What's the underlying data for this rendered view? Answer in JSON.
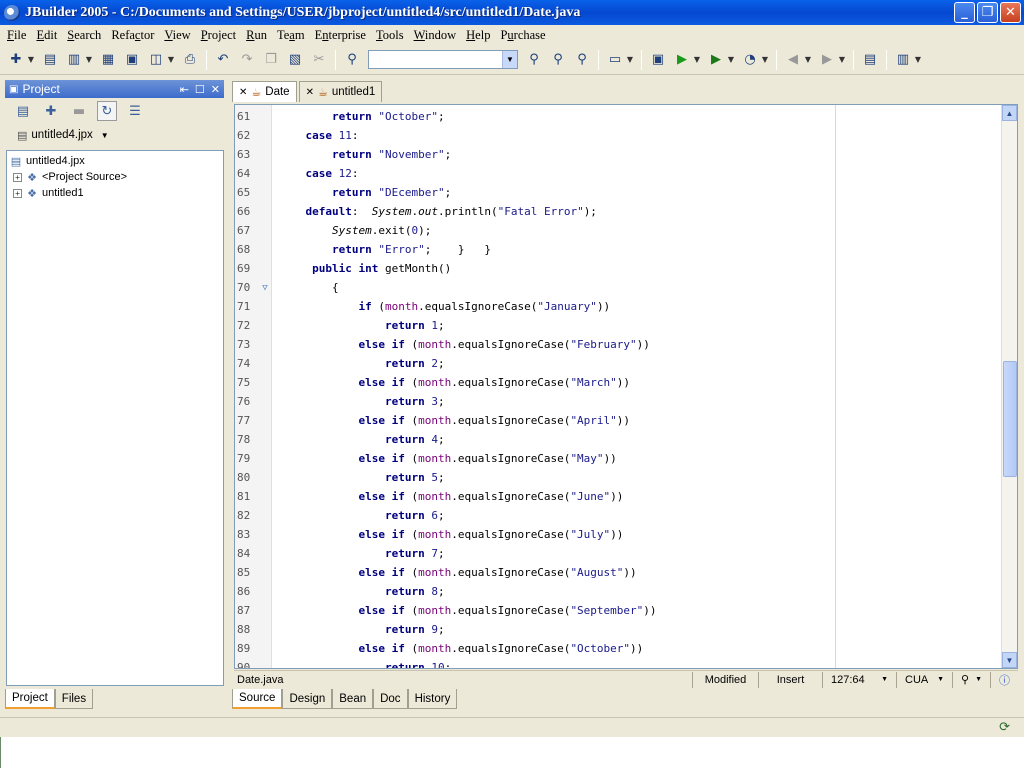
{
  "window": {
    "title": "JBuilder 2005 - C:/Documents and Settings/USER/jbproject/untitled4/src/untitled1/Date.java",
    "buttons": {
      "minimize": "_",
      "maximize": "❐",
      "close": "✕"
    }
  },
  "menu": [
    {
      "u": "F",
      "rest": "ile"
    },
    {
      "u": "E",
      "rest": "dit"
    },
    {
      "u": "S",
      "rest": "earch"
    },
    {
      "pre": "Refa",
      "u": "c",
      "rest": "tor"
    },
    {
      "u": "V",
      "rest": "iew"
    },
    {
      "u": "P",
      "rest": "roject"
    },
    {
      "u": "R",
      "rest": "un"
    },
    {
      "pre": "Te",
      "u": "a",
      "rest": "m"
    },
    {
      "pre": "E",
      "u": "n",
      "rest": "terprise"
    },
    {
      "u": "T",
      "rest": "ools"
    },
    {
      "u": "W",
      "rest": "indow"
    },
    {
      "u": "H",
      "rest": "elp"
    },
    {
      "pre": "P",
      "u": "u",
      "rest": "rchase"
    }
  ],
  "toolbar": {
    "search_combo_value": "",
    "icons": [
      "new-icon",
      "open-icon",
      "reopen-icon",
      "close-file-icon",
      "save-icon",
      "save-all-icon",
      "print-icon",
      "undo-icon",
      "redo-icon",
      "copy-icon",
      "paste-icon",
      "cut-icon",
      "find-icon",
      "find-next-icon",
      "find-classes-icon",
      "search-project-icon",
      "make-icon",
      "run-icon",
      "debug-icon",
      "optimize-icon",
      "back-icon",
      "forward-icon",
      "help-topics-icon",
      "workspace-icon"
    ]
  },
  "project_panel": {
    "title": "Project",
    "selected_project": "untitled4.jpx",
    "tree": [
      {
        "label": "untitled4.jpx",
        "level": 0
      },
      {
        "label": "<Project Source>",
        "level": 1
      },
      {
        "label": "untitled1",
        "level": 1
      }
    ],
    "tabs": [
      "Project",
      "Files"
    ]
  },
  "editor": {
    "tabs": [
      {
        "label": "Date",
        "active": true
      },
      {
        "label": "untitled1",
        "active": false
      }
    ],
    "lines": [
      {
        "n": "61",
        "indent": "        ",
        "tokens": [
          [
            "kw",
            "return"
          ],
          [
            "t",
            " "
          ],
          [
            "str",
            "\"October\""
          ],
          [
            "t",
            ";"
          ]
        ]
      },
      {
        "n": "62",
        "indent": "    ",
        "tokens": [
          [
            "kw",
            "case"
          ],
          [
            "t",
            " "
          ],
          [
            "num",
            "11"
          ],
          [
            "t",
            ":"
          ]
        ]
      },
      {
        "n": "63",
        "indent": "        ",
        "tokens": [
          [
            "kw",
            "return"
          ],
          [
            "t",
            " "
          ],
          [
            "str",
            "\"November\""
          ],
          [
            "t",
            ";"
          ]
        ]
      },
      {
        "n": "64",
        "indent": "    ",
        "tokens": [
          [
            "kw",
            "case"
          ],
          [
            "t",
            " "
          ],
          [
            "num",
            "12"
          ],
          [
            "t",
            ":"
          ]
        ]
      },
      {
        "n": "65",
        "indent": "        ",
        "tokens": [
          [
            "kw",
            "return"
          ],
          [
            "t",
            " "
          ],
          [
            "str",
            "\"DEcember\""
          ],
          [
            "t",
            ";"
          ]
        ]
      },
      {
        "n": "66",
        "indent": "    ",
        "tokens": [
          [
            "kw",
            "default"
          ],
          [
            "t",
            ":  "
          ],
          [
            "it",
            "System"
          ],
          [
            "t",
            "."
          ],
          [
            "it",
            "out"
          ],
          [
            "t",
            ".println("
          ],
          [
            "str",
            "\"Fatal Error\""
          ],
          [
            "t",
            ");"
          ]
        ]
      },
      {
        "n": "67",
        "indent": "        ",
        "tokens": [
          [
            "it",
            "System"
          ],
          [
            "t",
            ".exit("
          ],
          [
            "num",
            "0"
          ],
          [
            "t",
            ");"
          ]
        ]
      },
      {
        "n": "68",
        "indent": "        ",
        "tokens": [
          [
            "kw",
            "return"
          ],
          [
            "t",
            " "
          ],
          [
            "str",
            "\"Error\""
          ],
          [
            "t",
            ";    }   }"
          ]
        ]
      },
      {
        "n": "69",
        "indent": "     ",
        "tokens": [
          [
            "kw",
            "public"
          ],
          [
            "t",
            " "
          ],
          [
            "kw",
            "int"
          ],
          [
            "t",
            " getMonth()"
          ]
        ]
      },
      {
        "n": "70",
        "indent": "        ",
        "tokens": [
          [
            "t",
            "{"
          ]
        ],
        "fold": "▽"
      },
      {
        "n": "71",
        "indent": "            ",
        "tokens": [
          [
            "kw",
            "if"
          ],
          [
            "t",
            " ("
          ],
          [
            "fld",
            "month"
          ],
          [
            "t",
            ".equalsIgnoreCase("
          ],
          [
            "str",
            "\"January\""
          ],
          [
            "t",
            "))"
          ]
        ]
      },
      {
        "n": "72",
        "indent": "                ",
        "tokens": [
          [
            "kw",
            "return"
          ],
          [
            "t",
            " "
          ],
          [
            "num",
            "1"
          ],
          [
            "t",
            ";"
          ]
        ]
      },
      {
        "n": "73",
        "indent": "            ",
        "tokens": [
          [
            "kw",
            "else if"
          ],
          [
            "t",
            " ("
          ],
          [
            "fld",
            "month"
          ],
          [
            "t",
            ".equalsIgnoreCase("
          ],
          [
            "str",
            "\"February\""
          ],
          [
            "t",
            "))"
          ]
        ]
      },
      {
        "n": "74",
        "indent": "                ",
        "tokens": [
          [
            "kw",
            "return"
          ],
          [
            "t",
            " "
          ],
          [
            "num",
            "2"
          ],
          [
            "t",
            ";"
          ]
        ]
      },
      {
        "n": "75",
        "indent": "            ",
        "tokens": [
          [
            "kw",
            "else if"
          ],
          [
            "t",
            " ("
          ],
          [
            "fld",
            "month"
          ],
          [
            "t",
            ".equalsIgnoreCase("
          ],
          [
            "str",
            "\"March\""
          ],
          [
            "t",
            "))"
          ]
        ]
      },
      {
        "n": "76",
        "indent": "                ",
        "tokens": [
          [
            "kw",
            "return"
          ],
          [
            "t",
            " "
          ],
          [
            "num",
            "3"
          ],
          [
            "t",
            ";"
          ]
        ]
      },
      {
        "n": "77",
        "indent": "            ",
        "tokens": [
          [
            "kw",
            "else if"
          ],
          [
            "t",
            " ("
          ],
          [
            "fld",
            "month"
          ],
          [
            "t",
            ".equalsIgnoreCase("
          ],
          [
            "str",
            "\"April\""
          ],
          [
            "t",
            "))"
          ]
        ]
      },
      {
        "n": "78",
        "indent": "                ",
        "tokens": [
          [
            "kw",
            "return"
          ],
          [
            "t",
            " "
          ],
          [
            "num",
            "4"
          ],
          [
            "t",
            ";"
          ]
        ]
      },
      {
        "n": "79",
        "indent": "            ",
        "tokens": [
          [
            "kw",
            "else if"
          ],
          [
            "t",
            " ("
          ],
          [
            "fld",
            "month"
          ],
          [
            "t",
            ".equalsIgnoreCase("
          ],
          [
            "str",
            "\"May\""
          ],
          [
            "t",
            "))"
          ]
        ]
      },
      {
        "n": "80",
        "indent": "                ",
        "tokens": [
          [
            "kw",
            "return"
          ],
          [
            "t",
            " "
          ],
          [
            "num",
            "5"
          ],
          [
            "t",
            ";"
          ]
        ]
      },
      {
        "n": "81",
        "indent": "            ",
        "tokens": [
          [
            "kw",
            "else if"
          ],
          [
            "t",
            " ("
          ],
          [
            "fld",
            "month"
          ],
          [
            "t",
            ".equalsIgnoreCase("
          ],
          [
            "str",
            "\"June\""
          ],
          [
            "t",
            "))"
          ]
        ]
      },
      {
        "n": "82",
        "indent": "                ",
        "tokens": [
          [
            "kw",
            "return"
          ],
          [
            "t",
            " "
          ],
          [
            "num",
            "6"
          ],
          [
            "t",
            ";"
          ]
        ]
      },
      {
        "n": "83",
        "indent": "            ",
        "tokens": [
          [
            "kw",
            "else if"
          ],
          [
            "t",
            " ("
          ],
          [
            "fld",
            "month"
          ],
          [
            "t",
            ".equalsIgnoreCase("
          ],
          [
            "str",
            "\"July\""
          ],
          [
            "t",
            "))"
          ]
        ]
      },
      {
        "n": "84",
        "indent": "                ",
        "tokens": [
          [
            "kw",
            "return"
          ],
          [
            "t",
            " "
          ],
          [
            "num",
            "7"
          ],
          [
            "t",
            ";"
          ]
        ]
      },
      {
        "n": "85",
        "indent": "            ",
        "tokens": [
          [
            "kw",
            "else if"
          ],
          [
            "t",
            " ("
          ],
          [
            "fld",
            "month"
          ],
          [
            "t",
            ".equalsIgnoreCase("
          ],
          [
            "str",
            "\"August\""
          ],
          [
            "t",
            "))"
          ]
        ]
      },
      {
        "n": "86",
        "indent": "                ",
        "tokens": [
          [
            "kw",
            "return"
          ],
          [
            "t",
            " "
          ],
          [
            "num",
            "8"
          ],
          [
            "t",
            ";"
          ]
        ]
      },
      {
        "n": "87",
        "indent": "            ",
        "tokens": [
          [
            "kw",
            "else if"
          ],
          [
            "t",
            " ("
          ],
          [
            "fld",
            "month"
          ],
          [
            "t",
            ".equalsIgnoreCase("
          ],
          [
            "str",
            "\"September\""
          ],
          [
            "t",
            "))"
          ]
        ]
      },
      {
        "n": "88",
        "indent": "                ",
        "tokens": [
          [
            "kw",
            "return"
          ],
          [
            "t",
            " "
          ],
          [
            "num",
            "9"
          ],
          [
            "t",
            ";"
          ]
        ]
      },
      {
        "n": "89",
        "indent": "            ",
        "tokens": [
          [
            "kw",
            "else if"
          ],
          [
            "t",
            " ("
          ],
          [
            "fld",
            "month"
          ],
          [
            "t",
            ".equalsIgnoreCase("
          ],
          [
            "str",
            "\"October\""
          ],
          [
            "t",
            "))"
          ]
        ]
      },
      {
        "n": "90",
        "indent": "                ",
        "tokens": [
          [
            "kw",
            "return"
          ],
          [
            "t",
            " "
          ],
          [
            "num",
            "10"
          ],
          [
            "t",
            ";"
          ]
        ]
      }
    ],
    "status": {
      "file": "Date.java",
      "modified": "Modified",
      "mode": "Insert",
      "position": "127:64",
      "keymap": "CUA"
    },
    "bottom_tabs": [
      "Source",
      "Design",
      "Bean",
      "Doc",
      "History"
    ],
    "active_bottom_tab": "Source"
  }
}
